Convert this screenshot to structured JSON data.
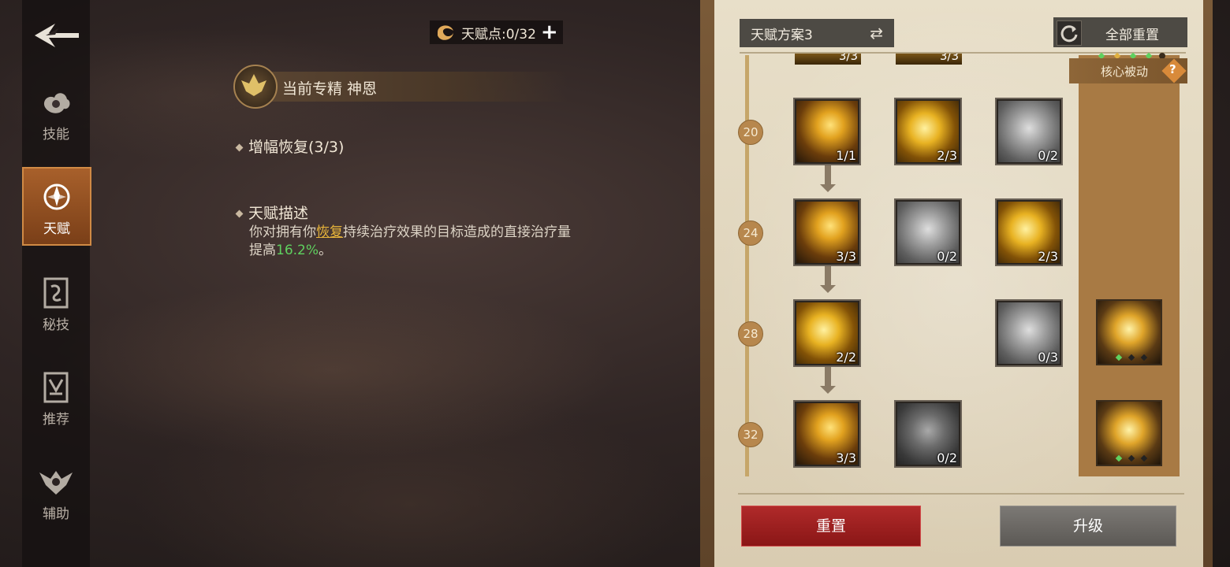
{
  "nav": {
    "items": [
      {
        "label": "技能",
        "icon": "cloud-swirl-icon"
      },
      {
        "label": "天赋",
        "icon": "talent-emblem-icon",
        "active": true
      },
      {
        "label": "秘技",
        "icon": "secret-book-icon"
      },
      {
        "label": "推荐",
        "icon": "recommend-banner-icon"
      },
      {
        "label": "辅助",
        "icon": "assist-wings-icon"
      }
    ]
  },
  "top": {
    "points_label": "天赋点:0/32"
  },
  "spec": {
    "label": "当前专精 神恩"
  },
  "talent": {
    "name": "增幅恢复(3/3)",
    "desc_header": "天赋描述",
    "desc_part1": "你对拥有你",
    "desc_highlight": "恢复",
    "desc_part2": "持续治疗效果的目标造成的直接治疗量提高",
    "desc_value": "16.2%",
    "desc_end": "。"
  },
  "panel": {
    "scheme_label": "天赋方案3",
    "reset_all_label": "全部重置",
    "core_passive_label": "核心被动",
    "levels": [
      "20",
      "24",
      "28",
      "32"
    ],
    "partial_ranks": [
      "3/3",
      "3/3"
    ],
    "rows": [
      [
        "1/1",
        "2/3",
        "0/2"
      ],
      [
        "3/3",
        "0/2",
        "2/3"
      ],
      [
        "2/2",
        "",
        "0/3"
      ],
      [
        "3/3",
        "0/2",
        ""
      ]
    ],
    "reset_label": "重置",
    "upgrade_label": "升级"
  },
  "colors": {
    "highlight_yellow": "#e8b53a",
    "value_green": "#5fd05f",
    "reset_red": "#a82020"
  }
}
